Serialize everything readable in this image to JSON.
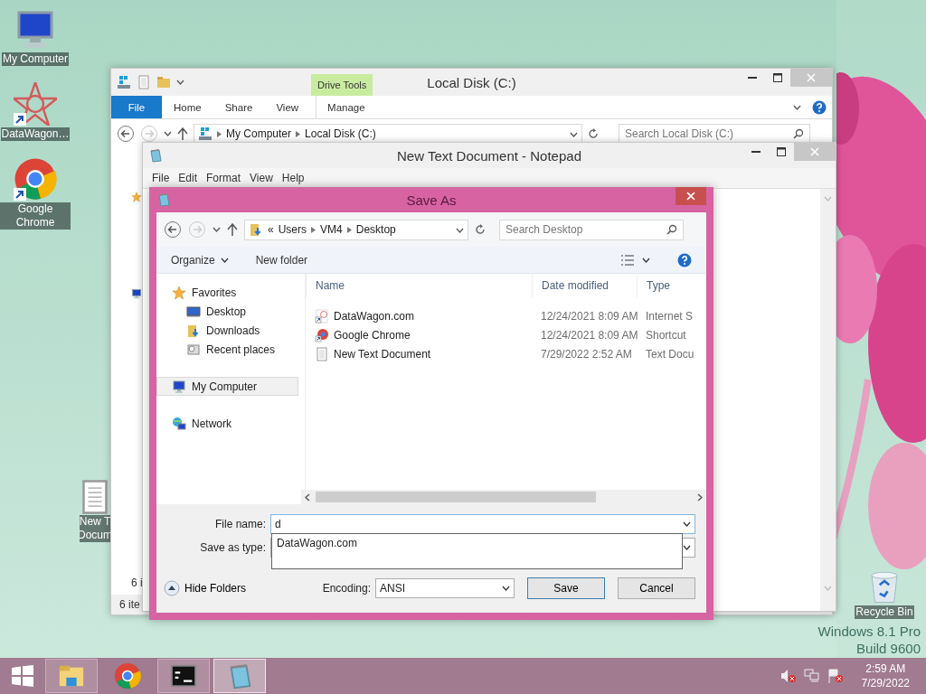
{
  "desktop": {
    "icons": [
      {
        "kind": "computer",
        "label": "My Computer",
        "shortcut": false
      },
      {
        "kind": "star_logo",
        "label": "DataWagon…",
        "shortcut": true
      },
      {
        "kind": "chrome",
        "label": "Google Chrome",
        "shortcut": true
      }
    ],
    "covered_icon": {
      "kind": "text_file",
      "lines": [
        "New T",
        "Docum"
      ]
    },
    "recycle_bin": {
      "label": "Recycle Bin"
    },
    "os_version": [
      "Windows 8.1 Pro",
      "Build 9600"
    ]
  },
  "explorer": {
    "title": "Local Disk (C:)",
    "context_group": "Drive Tools",
    "tabs": [
      {
        "label": "File",
        "kind": "file"
      },
      {
        "label": "Home",
        "kind": "tab"
      },
      {
        "label": "Share",
        "kind": "tab"
      },
      {
        "label": "View",
        "kind": "tab"
      },
      {
        "label": "Manage",
        "kind": "context"
      }
    ],
    "path": [
      "My Computer",
      "Local Disk (C:)"
    ],
    "search_placeholder": "Search Local Disk (C:)",
    "item_count": "6 i",
    "status_bar": "6 ite"
  },
  "notepad": {
    "title": "New Text Document - Notepad",
    "menu": [
      "File",
      "Edit",
      "Format",
      "View",
      "Help"
    ]
  },
  "save_dialog": {
    "title": "Save As",
    "path_overflow": "«",
    "path": [
      "Users",
      "VM4",
      "Desktop"
    ],
    "search_placeholder": "Search Desktop",
    "organize": "Organize",
    "new_folder": "New folder",
    "nav": [
      {
        "label": "Favorites",
        "kind": "star",
        "selected": false,
        "children": [
          {
            "label": "Desktop",
            "kind": "desktop",
            "selected": false
          },
          {
            "label": "Downloads",
            "kind": "downloads",
            "selected": false
          },
          {
            "label": "Recent places",
            "kind": "recent",
            "selected": false
          }
        ]
      },
      {
        "label": "My Computer",
        "kind": "computer",
        "selected": true
      },
      {
        "label": "Network",
        "kind": "network",
        "selected": false
      }
    ],
    "columns": [
      "Name",
      "Date modified",
      "Type"
    ],
    "files": [
      {
        "name": "DataWagon.com",
        "date": "12/24/2021 8:09 AM",
        "type": "Internet S",
        "kind": "url"
      },
      {
        "name": "Google Chrome",
        "date": "12/24/2021 8:09 AM",
        "type": "Shortcut",
        "kind": "shortcut"
      },
      {
        "name": "New Text Document",
        "date": "7/29/2022 2:52 AM",
        "type": "Text Docu",
        "kind": "text"
      }
    ],
    "file_name_label": "File name:",
    "file_name": "d",
    "suggestions": [
      "DataWagon.com"
    ],
    "save_type_label": "Save as type:",
    "hide_folders": "Hide Folders",
    "encoding_label": "Encoding:",
    "encoding": "ANSI",
    "buttons": [
      {
        "label": "Save",
        "default": true
      },
      {
        "label": "Cancel",
        "default": false
      }
    ]
  },
  "taskbar": {
    "apps": [
      {
        "kind": "explorer",
        "running": true,
        "selected": false
      },
      {
        "kind": "chrome",
        "running": false,
        "selected": false
      },
      {
        "kind": "cmd",
        "running": true,
        "selected": false
      },
      {
        "kind": "notepad",
        "running": true,
        "selected": true
      }
    ],
    "time": "2:59 AM",
    "date": "7/29/2022"
  }
}
